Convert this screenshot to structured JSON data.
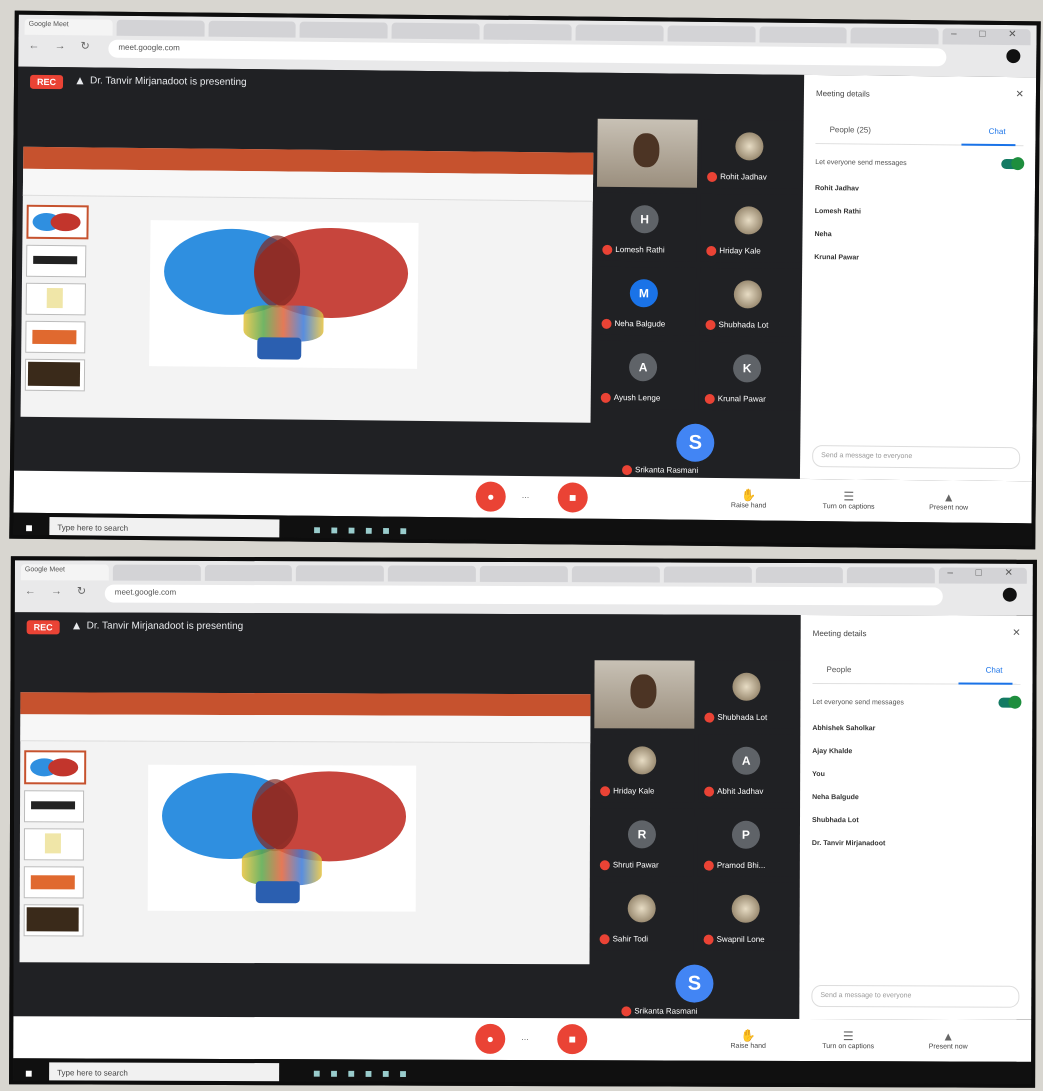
{
  "screens": [
    {
      "tabs": [
        "Google Meet",
        "",
        "",
        "",
        "",
        "",
        "",
        "",
        "",
        "",
        ""
      ],
      "address": "meet.google.com",
      "rec_label": "REC",
      "presenter": "Dr. Tanvir Mirjanadoot is presenting",
      "self_view": true,
      "participants": [
        {
          "name": "Rohit Jadhav",
          "initial": "",
          "kind": "photo"
        },
        {
          "name": "Lomesh Rathi",
          "initial": "H",
          "kind": "letter"
        },
        {
          "name": "Hriday Kale",
          "initial": "",
          "kind": "photo"
        },
        {
          "name": "Neha Balgude",
          "initial": "M",
          "kind": "blue"
        },
        {
          "name": "Shubhada Lot",
          "initial": "",
          "kind": "photo"
        },
        {
          "name": "Ayush Lenge",
          "initial": "A",
          "kind": "letter"
        },
        {
          "name": "Krunal Pawar",
          "initial": "K",
          "kind": "letter"
        }
      ],
      "last_speaker": {
        "name": "Srikanta Rasmani",
        "initial": "S"
      },
      "side_title": "Meeting details",
      "side_tab_people": "People (25)",
      "side_tab_chat": "Chat",
      "toggle_label": "Let everyone send messages",
      "messages": [
        {
          "who": "Rohit Jadhav",
          "when": "",
          "body": ""
        },
        {
          "who": "Lomesh Rathi",
          "when": "",
          "body": ""
        },
        {
          "who": "Neha",
          "when": "",
          "body": ""
        },
        {
          "who": "Krunal Pawar",
          "when": "",
          "body": ""
        }
      ],
      "chat_placeholder": "Send a message to everyone",
      "meeting_info": "",
      "bar_more": "...",
      "bar_right": [
        "Raise hand",
        "Turn on captions",
        "Present now"
      ],
      "search_placeholder": "Type here to search",
      "clock": ""
    },
    {
      "tabs": [
        "Google Meet",
        "",
        "",
        "",
        "",
        "",
        "",
        "",
        "",
        "",
        ""
      ],
      "address": "meet.google.com",
      "rec_label": "REC",
      "presenter": "Dr. Tanvir Mirjanadoot is presenting",
      "self_view": true,
      "participants": [
        {
          "name": "Shubhada Lot",
          "initial": "",
          "kind": "photo"
        },
        {
          "name": "Hriday Kale",
          "initial": "",
          "kind": "photo"
        },
        {
          "name": "Abhit Jadhav",
          "initial": "A",
          "kind": "letter"
        },
        {
          "name": "Shruti Pawar",
          "initial": "R",
          "kind": "letter"
        },
        {
          "name": "Pramod Bhi...",
          "initial": "P",
          "kind": "letter"
        },
        {
          "name": "Sahir Todi",
          "initial": "",
          "kind": "photo"
        },
        {
          "name": "Swapnil Lone",
          "initial": "",
          "kind": "photo"
        }
      ],
      "last_speaker": {
        "name": "Srikanta Rasmani",
        "initial": "S"
      },
      "side_title": "Meeting details",
      "side_tab_people": "People",
      "side_tab_chat": "Chat",
      "toggle_label": "Let everyone send messages",
      "messages": [
        {
          "who": "Abhishek Saholkar",
          "when": "",
          "body": ""
        },
        {
          "who": "Ajay Khalde",
          "when": "",
          "body": ""
        },
        {
          "who": "You",
          "when": "",
          "body": ""
        },
        {
          "who": "Neha Balgude",
          "when": "",
          "body": ""
        },
        {
          "who": "Shubhada Lot",
          "when": "",
          "body": ""
        },
        {
          "who": "Dr. Tanvir Mirjanadoot",
          "when": "",
          "body": ""
        }
      ],
      "chat_placeholder": "Send a message to everyone",
      "meeting_info": "",
      "bar_more": "...",
      "bar_right": [
        "Raise hand",
        "Turn on captions",
        "Present now"
      ],
      "search_placeholder": "Type here to search",
      "clock": ""
    }
  ],
  "colors": {
    "meet_bg": "#202124",
    "end_call": "#ea4335",
    "ppt_ribbon": "#c6522e",
    "accent": "#1a73e8",
    "toggle": "#1e8e3e"
  }
}
